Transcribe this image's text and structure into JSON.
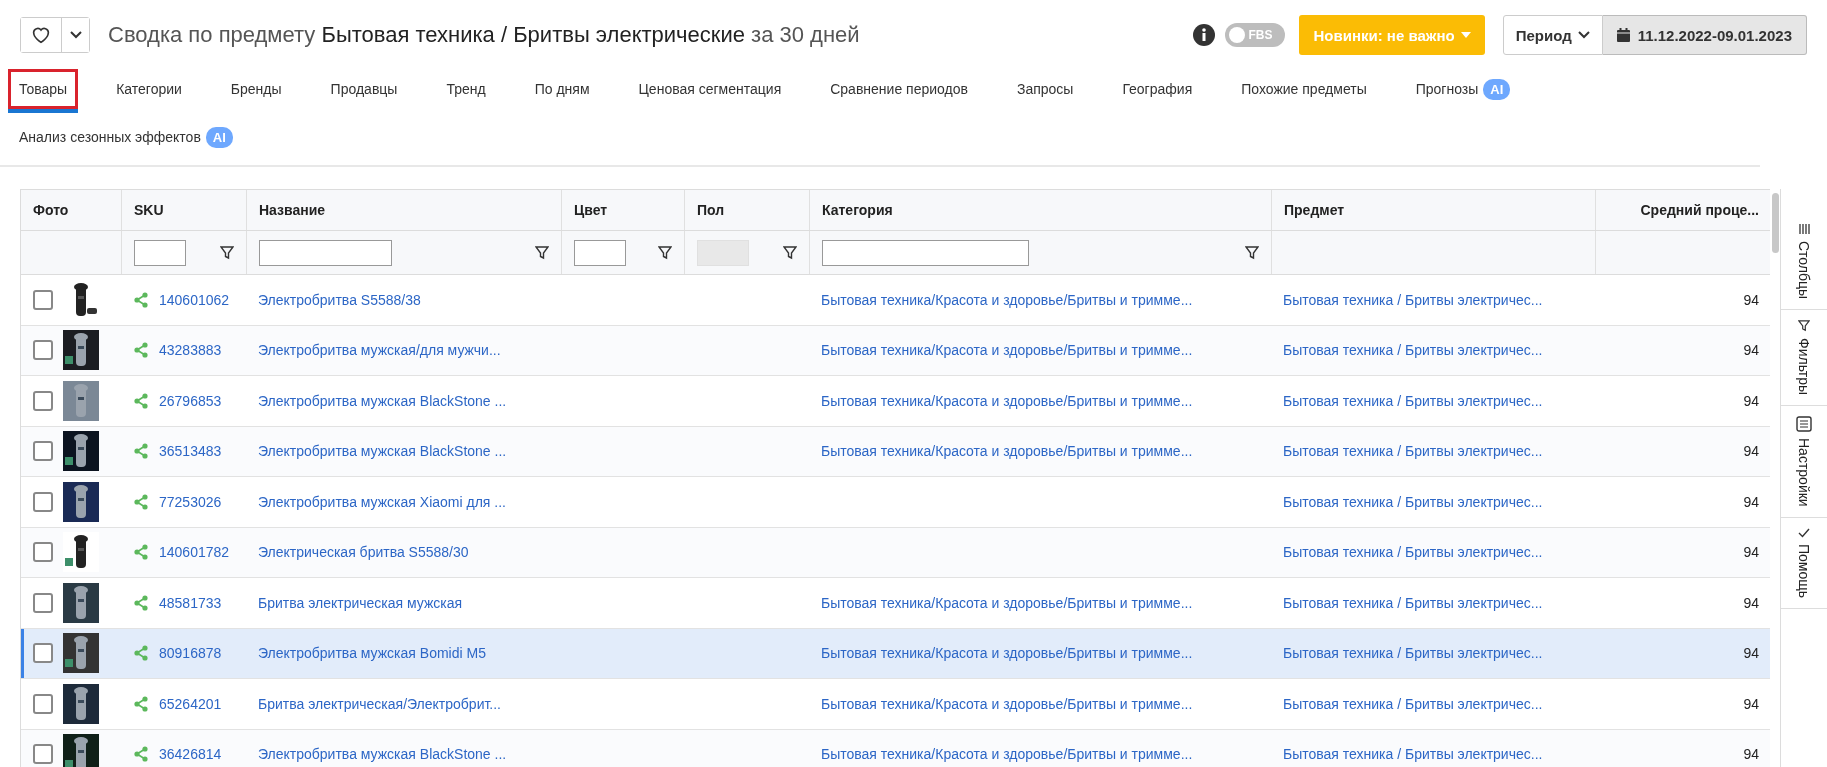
{
  "header": {
    "title_prefix": "Сводка по предмету",
    "title_subject": "Бытовая техника / Бритвы электрические",
    "title_suffix": "за 30 дней",
    "fbs": {
      "label": "FBS",
      "on": false
    },
    "novelty_button": "Новинки: не важно",
    "period_button": "Период",
    "date_range": "11.12.2022-09.01.2023"
  },
  "tabs": [
    {
      "label": "Товары",
      "selected": true,
      "highlighted": true
    },
    {
      "label": "Категории",
      "selected": false,
      "highlighted": false
    },
    {
      "label": "Бренды",
      "selected": false,
      "highlighted": false
    },
    {
      "label": "Продавцы",
      "selected": false,
      "highlighted": false
    },
    {
      "label": "Тренд",
      "selected": false,
      "highlighted": false
    },
    {
      "label": "По дням",
      "selected": false,
      "highlighted": false
    },
    {
      "label": "Ценовая сегментация",
      "selected": false,
      "highlighted": false
    },
    {
      "label": "Сравнение периодов",
      "selected": false,
      "highlighted": false
    },
    {
      "label": "Запросы",
      "selected": false,
      "highlighted": false
    },
    {
      "label": "География",
      "selected": false,
      "highlighted": false
    },
    {
      "label": "Похожие предметы",
      "selected": false,
      "highlighted": false
    },
    {
      "label": "Прогнозы",
      "badge": "AI",
      "selected": false,
      "highlighted": false
    },
    {
      "label": "Анализ сезонных эффектов",
      "badge": "AI",
      "selected": false,
      "highlighted": false
    }
  ],
  "table": {
    "columns": [
      {
        "label": "Фото",
        "kind": "plain"
      },
      {
        "label": "SKU",
        "kind": "filterable"
      },
      {
        "label": "Название",
        "kind": "filterable"
      },
      {
        "label": "Цвет",
        "kind": "filterable"
      },
      {
        "label": "Пол",
        "kind": "locked"
      },
      {
        "label": "Категория",
        "kind": "filterable"
      },
      {
        "label": "Предмет",
        "kind": "plain"
      },
      {
        "label": "Средний проце...",
        "kind": "plain"
      }
    ],
    "rows": [
      {
        "selected": false,
        "checked": false,
        "sku": "140601062",
        "name": "Электробритва S5588/38",
        "category": "Бытовая техника/Красота и здоровье/Бритвы и тримме...",
        "subject": "Бытовая техника / Бритвы электричес...",
        "value": "94"
      },
      {
        "selected": false,
        "checked": false,
        "sku": "43283883",
        "name": "Электробритва мужская/для мужчи...",
        "category": "Бытовая техника/Красота и здоровье/Бритвы и тримме...",
        "subject": "Бытовая техника / Бритвы электричес...",
        "value": "94"
      },
      {
        "selected": false,
        "checked": false,
        "sku": "26796853",
        "name": "Электробритва мужская BlackStone ...",
        "category": "Бытовая техника/Красота и здоровье/Бритвы и тримме...",
        "subject": "Бытовая техника / Бритвы электричес...",
        "value": "94"
      },
      {
        "selected": false,
        "checked": false,
        "sku": "36513483",
        "name": "Электробритва мужская BlackStone ...",
        "category": "Бытовая техника/Красота и здоровье/Бритвы и тримме...",
        "subject": "Бытовая техника / Бритвы электричес...",
        "value": "94"
      },
      {
        "selected": false,
        "checked": false,
        "sku": "77253026",
        "name": "Электробритва мужская Xiaomi для ...",
        "subject": "Бытовая техника / Бритвы электричес...",
        "value": "94"
      },
      {
        "selected": false,
        "checked": false,
        "sku": "140601782",
        "name": "Электрическая бритва S5588/30",
        "subject": "Бытовая техника / Бритвы электричес...",
        "value": "94"
      },
      {
        "selected": false,
        "checked": false,
        "sku": "48581733",
        "name": "Бритва электрическая мужская",
        "category": "Бытовая техника/Красота и здоровье/Бритвы и тримме...",
        "subject": "Бытовая техника / Бритвы электричес...",
        "value": "94"
      },
      {
        "selected": true,
        "checked": false,
        "sku": "80916878",
        "name": "Электробритва мужская Bomidi M5",
        "category": "Бытовая техника/Красота и здоровье/Бритвы и тримме...",
        "subject": "Бытовая техника / Бритвы электричес...",
        "value": "94"
      },
      {
        "selected": false,
        "checked": false,
        "sku": "65264201",
        "name": "Бритва электрическая/Электробрит...",
        "category": "Бытовая техника/Красота и здоровье/Бритвы и тримме...",
        "subject": "Бытовая техника / Бритвы электричес...",
        "value": "94"
      },
      {
        "selected": false,
        "checked": false,
        "sku": "36426814",
        "name": "Электробритва мужская BlackStone ...",
        "category": "Бытовая техника/Красота и здоровье/Бритвы и тримме...",
        "subject": "Бытовая техника / Бритвы электричес...",
        "value": "94"
      }
    ]
  },
  "side_panel": [
    {
      "label": "Столбцы"
    },
    {
      "label": "Фильтры"
    },
    {
      "label": "Настройки"
    },
    {
      "label": "Помощь"
    }
  ]
}
